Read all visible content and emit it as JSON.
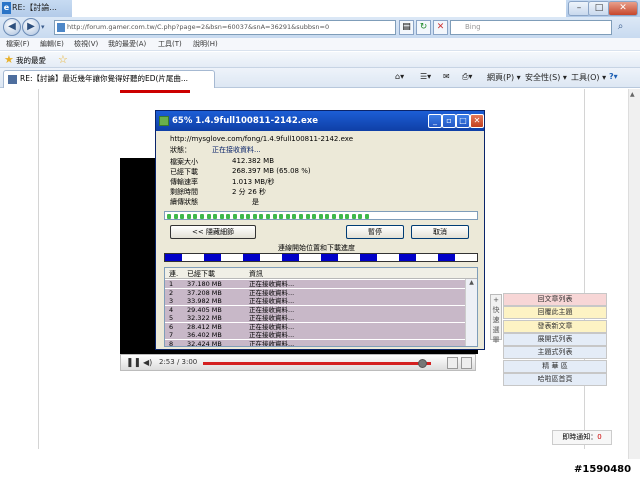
{
  "browser": {
    "title": "RE:【討論...",
    "address": "http://forum.gamer.com.tw/C.php?page=2&bsn=60037&snA=36291&subbsn=0",
    "search_placeholder": "Bing",
    "menu": [
      "檔案(F)",
      "編輯(E)",
      "檢視(V)",
      "我的最愛(A)",
      "工具(T)",
      "說明(H)"
    ],
    "favorites_label": "我的最愛",
    "tab_title": "RE:【討論】最近幾年讓你覺得好聽的ED(片尾曲...",
    "commands": [
      "網頁(P) ▾",
      "安全性(S) ▾",
      "工具(O) ▾"
    ]
  },
  "download": {
    "title": "65% 1.4.9full100811-2142.exe",
    "url": "http://mysglove.com/fong/1.4.9full100811-2142.exe",
    "status_label": "狀態：",
    "status_value": "正在接收資料...",
    "rows": [
      {
        "label": "檔案大小",
        "value": "412.382 MB"
      },
      {
        "label": "已經下載",
        "value": "268.397 MB (65.08 %)"
      },
      {
        "label": "傳輸速率",
        "value": "1.013 MB/秒"
      },
      {
        "label": "剩餘時間",
        "value": "2 分 26 秒"
      },
      {
        "label": "續傳狀態",
        "value": "是"
      }
    ],
    "progress_fraction": 0.6508,
    "hide_button": "<< 隱藏細節",
    "pause_button": "暫停",
    "cancel_button": "取消",
    "conn_caption": "連線開始位置和下載進度",
    "list_headers": [
      "連.",
      "已經下載",
      "資訊"
    ],
    "connections": [
      {
        "n": "1",
        "dl": "37.180 MB",
        "info": "正在接收資料..."
      },
      {
        "n": "2",
        "dl": "37.208 MB",
        "info": "正在接收資料..."
      },
      {
        "n": "3",
        "dl": "33.982 MB",
        "info": "正在接收資料..."
      },
      {
        "n": "4",
        "dl": "29.405 MB",
        "info": "正在接收資料..."
      },
      {
        "n": "5",
        "dl": "32.322 MB",
        "info": "正在接收資料..."
      },
      {
        "n": "6",
        "dl": "28.412 MB",
        "info": "正在接收資料..."
      },
      {
        "n": "7",
        "dl": "36.402 MB",
        "info": "正在接收資料..."
      },
      {
        "n": "8",
        "dl": "32.424 MB",
        "info": "正在接收資料..."
      }
    ]
  },
  "player": {
    "time": "2:53 / 3:00",
    "position_fraction": 0.96
  },
  "quickbar": [
    "+",
    "快",
    "速",
    "選",
    "單"
  ],
  "side_menu": [
    {
      "label": "回文章列表",
      "bg": "#f7d6d6"
    },
    {
      "label": "回覆此主題",
      "bg": "#fdf3c4"
    },
    {
      "label": "發表新文章",
      "bg": "#fdf3c4"
    },
    {
      "label": "展開式列表",
      "bg": "#e4ecf7"
    },
    {
      "label": "主題式列表",
      "bg": "#e4ecf7"
    },
    {
      "label": "精 華 區",
      "bg": "#e4ecf7"
    },
    {
      "label": "哈啦區首頁",
      "bg": "#e4ecf7"
    }
  ],
  "notify": {
    "label": "即時通知：",
    "count": "0"
  },
  "watermark": "#1590480"
}
